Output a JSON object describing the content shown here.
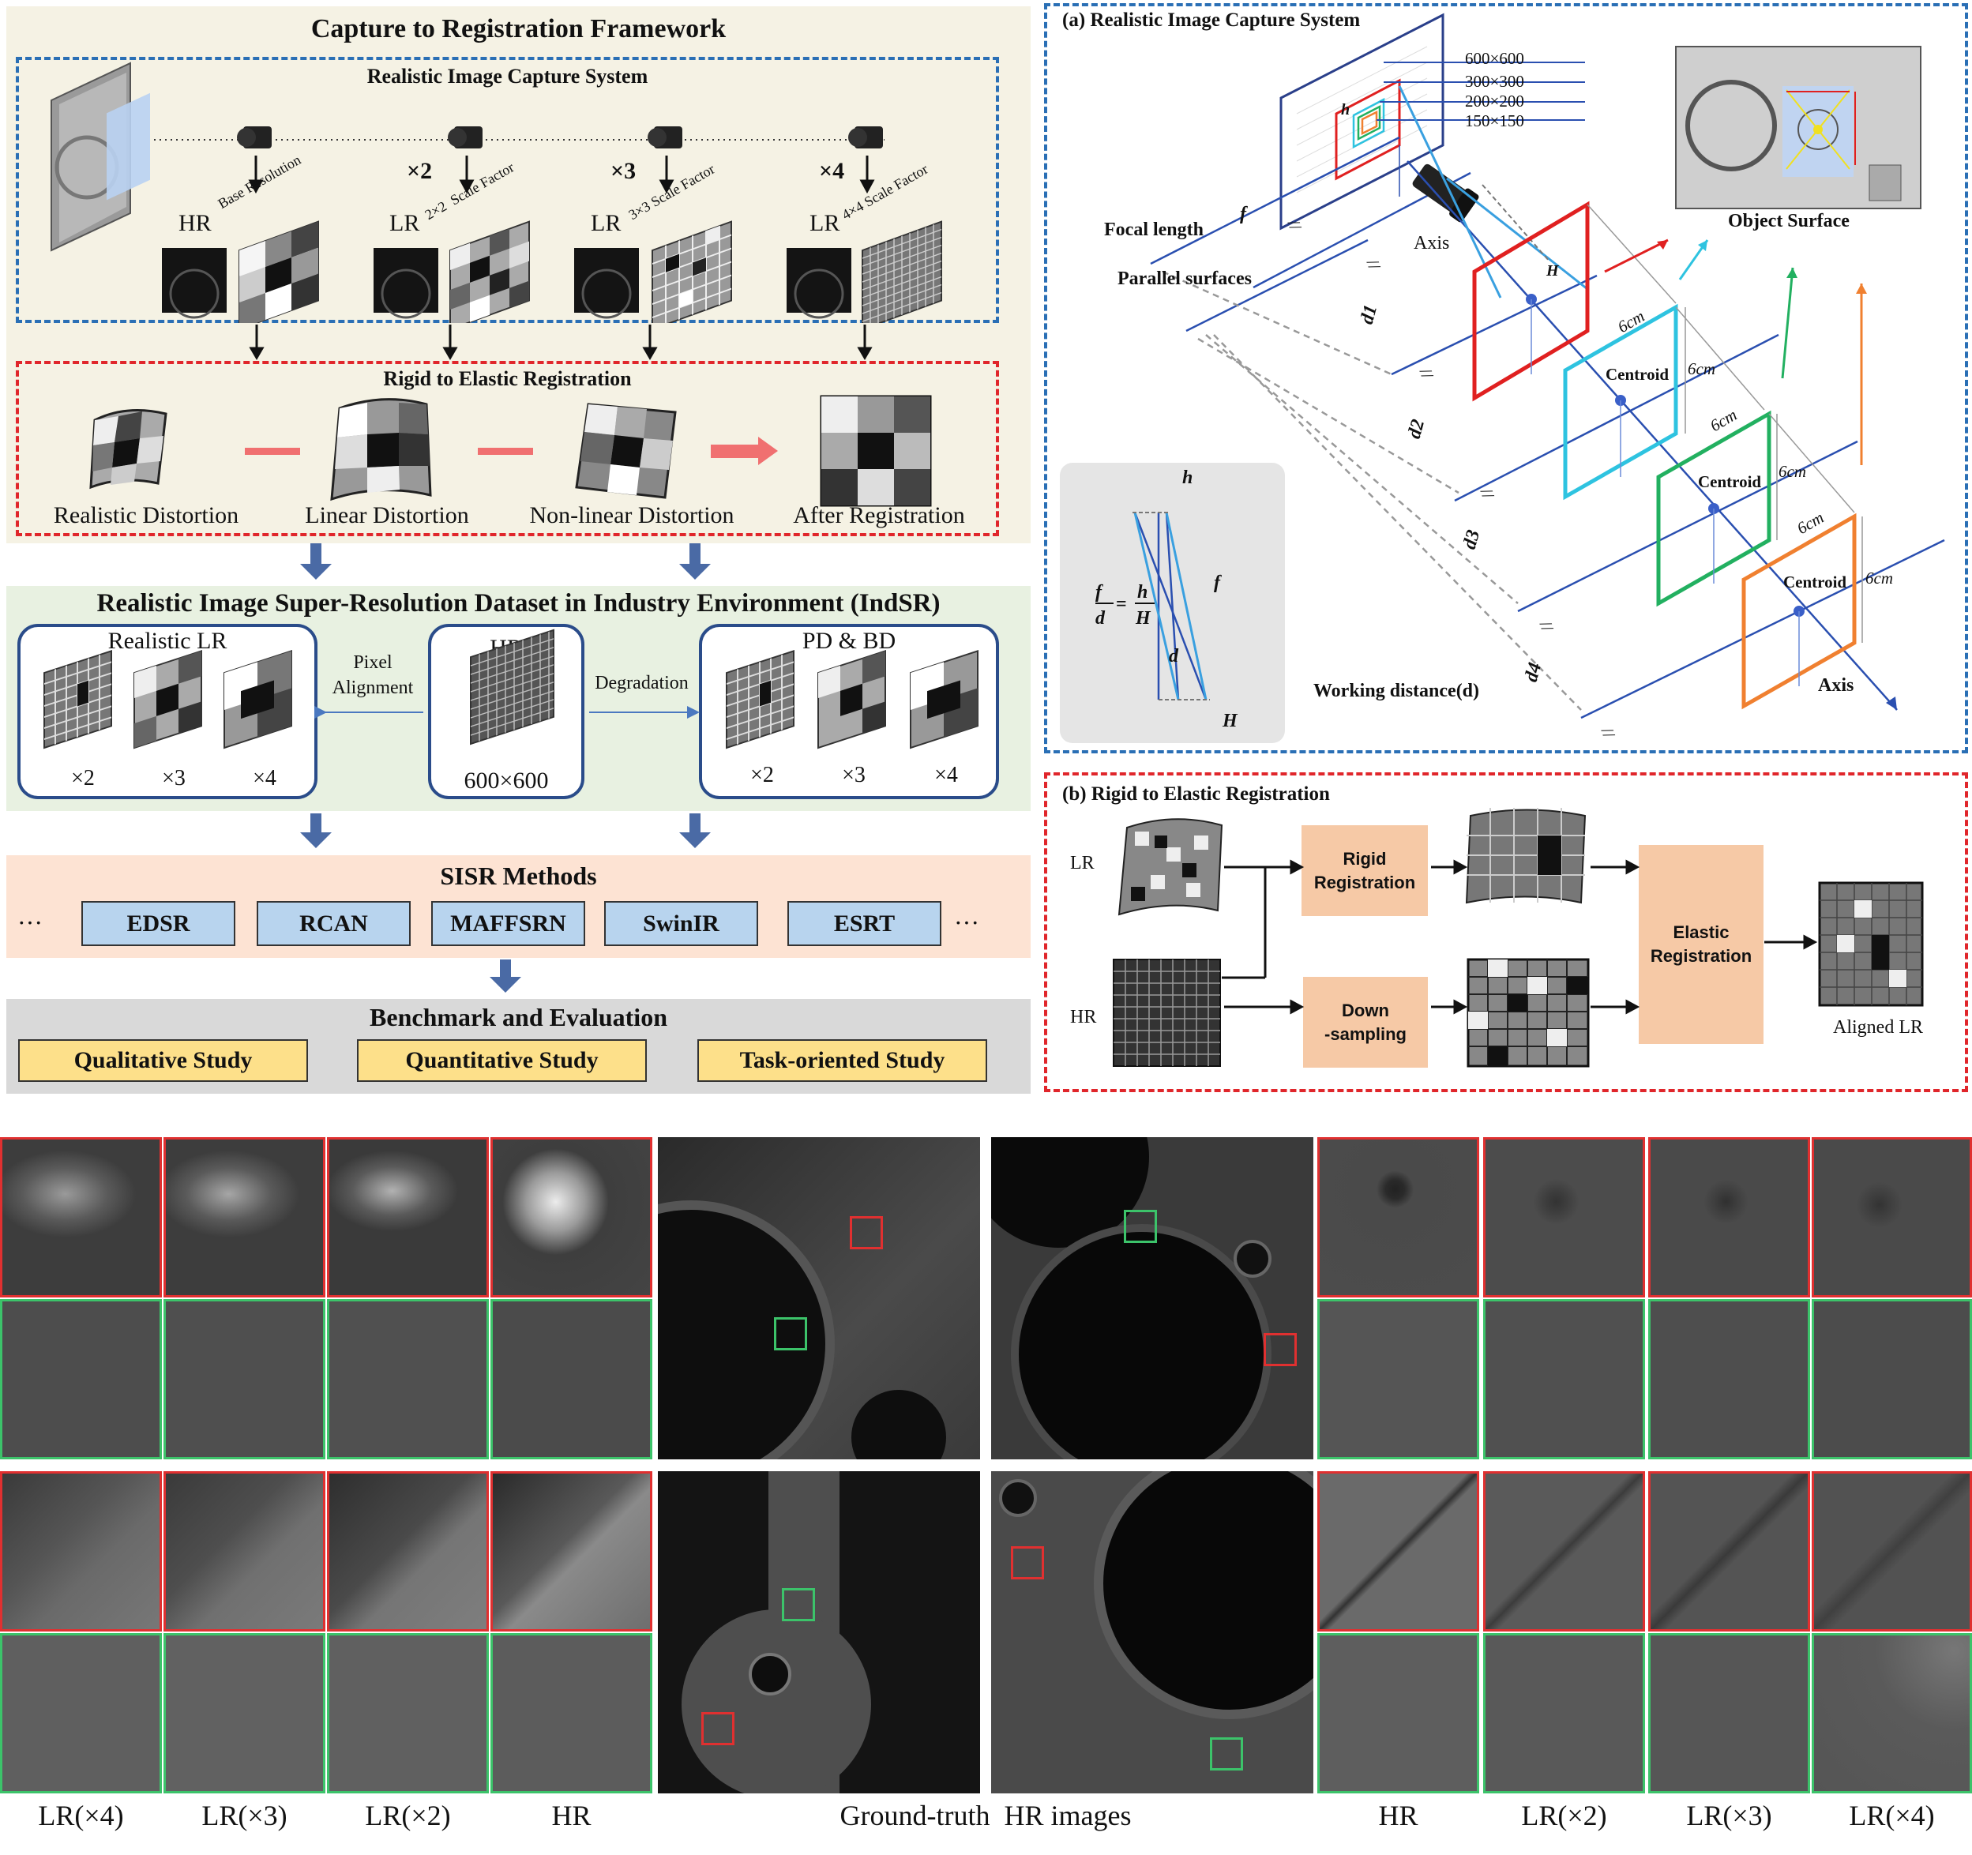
{
  "framework": {
    "title": "Capture to Registration Framework",
    "capture": {
      "title": "Realistic Image Capture System",
      "hr_label": "HR",
      "base_label": "Base Resolution",
      "lr_label": "LR",
      "scales": [
        {
          "factor": "×2",
          "scale_text": "2×2  Scale Factor"
        },
        {
          "factor": "×3",
          "scale_text": "3×3 Scale Factor"
        },
        {
          "factor": "×4",
          "scale_text": "4×4 Scale Factor"
        }
      ]
    },
    "registration": {
      "title": "Rigid to Elastic Registration",
      "items": [
        "Realistic Distortion",
        "Linear Distortion",
        "Non-linear Distortion",
        "After Registration"
      ]
    },
    "dataset": {
      "title": "Realistic Image Super-Resolution Dataset in Industry Environment (IndSR)",
      "realistic_lr": "Realistic LR",
      "hr": "HR",
      "hr_size": "600×600",
      "pd_bd": "PD & BD",
      "pixel_alignment": "Pixel\nAlignment",
      "degradation": "Degradation",
      "factors": [
        "×2",
        "×3",
        "×4"
      ]
    },
    "sisr": {
      "title": "SISR Methods",
      "ellipsis": "···",
      "methods": [
        "EDSR",
        "RCAN",
        "MAFFSRN",
        "SwinIR",
        "ESRT"
      ]
    },
    "benchmark": {
      "title": "Benchmark and Evaluation",
      "studies": [
        "Qualitative Study",
        "Quantitative Study",
        "Task-oriented Study"
      ]
    }
  },
  "panel_a": {
    "title": "(a) Realistic Image Capture System",
    "sizes": [
      "600×600",
      "300×300",
      "200×200",
      "150×150"
    ],
    "focal_length": "Focal length",
    "parallel_surfaces": "Parallel surfaces",
    "axis": "Axis",
    "object_surface": "Object Surface",
    "centroid": "Centroid",
    "six_cm": "6cm",
    "working_distance": "Working distance(d)",
    "symbols": {
      "h": "h",
      "H": "H",
      "f": "f",
      "d": "d",
      "d1": "d1",
      "d2": "d2",
      "d3": "d3",
      "d4": "d4",
      "parallel": "//"
    },
    "formula": {
      "f": "f",
      "d": "d",
      "h": "h",
      "H": "H",
      "eq": "="
    }
  },
  "panel_b": {
    "title": "(b) Rigid to Elastic Registration",
    "lr": "LR",
    "hr": "HR",
    "rigid": "Rigid\nRegistration",
    "down": "Down\n-sampling",
    "elastic": "Elastic\nRegistration",
    "aligned": "Aligned LR"
  },
  "bottom": {
    "left_labels": [
      "LR(×4)",
      "LR(×3)",
      "LR(×2)",
      "HR"
    ],
    "center_label": "Ground-truth  HR images",
    "right_labels": [
      "HR",
      "LR(×2)",
      "LR(×3)",
      "LR(×4)"
    ]
  },
  "colors": {
    "blue_dash": "#2a6fb5",
    "red_dash": "#e0262b",
    "framework_bg": "#f5f2e4",
    "dataset_bg": "#e8f1e1",
    "sisr_bg": "#fde3d3",
    "bench_bg": "#d9d9d9",
    "method_fill": "#b8d4ee",
    "study_fill": "#fde08a",
    "peach": "#f6c9a6"
  }
}
